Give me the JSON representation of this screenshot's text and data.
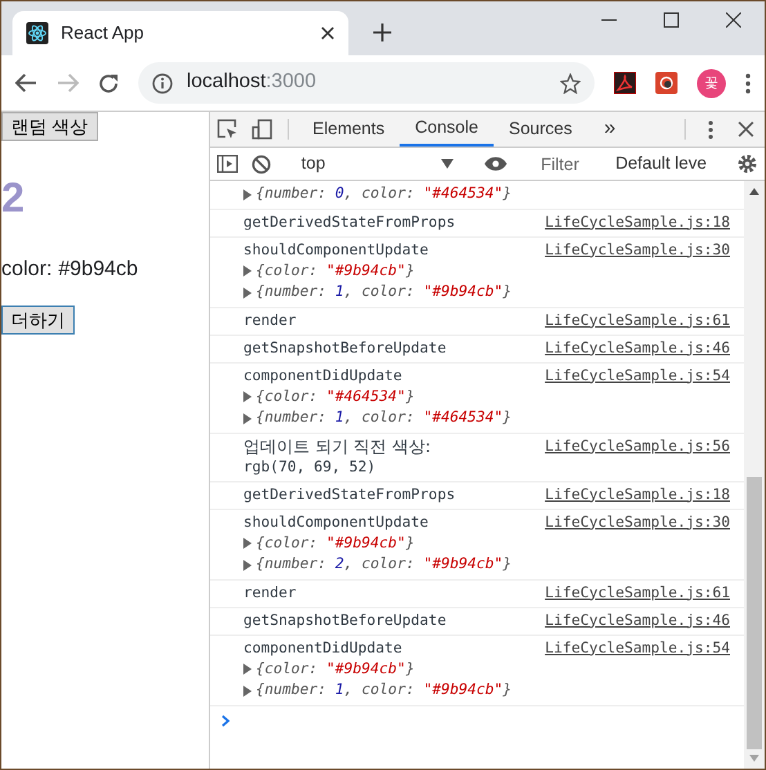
{
  "browser": {
    "tab_title": "React App",
    "url_host": "localhost",
    "url_port": ":3000",
    "forward_disabled": true,
    "avatar_label": "꽃"
  },
  "page": {
    "random_button": "랜덤 색상",
    "number": "2",
    "number_color": "#9b94cb",
    "color_key": "color:",
    "add_button": "더하기"
  },
  "devtools": {
    "tabs": [
      {
        "label": "Elements",
        "selected": false
      },
      {
        "label": "Console",
        "selected": true
      },
      {
        "label": "Sources",
        "selected": false
      }
    ],
    "more_tabs": "»",
    "context": "top",
    "filter_placeholder": "Filter",
    "levels": "Default leve"
  },
  "console": [
    {
      "objects": [
        [
          {
            "kind": "plain",
            "text": "{number: "
          },
          {
            "kind": "number",
            "text": "0"
          },
          {
            "kind": "plain",
            "text": ", color: "
          },
          {
            "kind": "string",
            "text": "\"#464534\""
          },
          {
            "kind": "plain",
            "text": "}"
          }
        ]
      ]
    },
    {
      "lines": [
        "getDerivedStateFromProps"
      ],
      "source": "LifeCycleSample.js:18"
    },
    {
      "lines": [
        "shouldComponentUpdate"
      ],
      "source": "LifeCycleSample.js:30",
      "objects": [
        [
          {
            "kind": "plain",
            "text": "{color: "
          },
          {
            "kind": "string",
            "text": "\"#9b94cb\""
          },
          {
            "kind": "plain",
            "text": "}"
          }
        ],
        [
          {
            "kind": "plain",
            "text": "{number: "
          },
          {
            "kind": "number",
            "text": "1"
          },
          {
            "kind": "plain",
            "text": ", color: "
          },
          {
            "kind": "string",
            "text": "\"#9b94cb\""
          },
          {
            "kind": "plain",
            "text": "}"
          }
        ]
      ]
    },
    {
      "lines": [
        "render"
      ],
      "source": "LifeCycleSample.js:61"
    },
    {
      "lines": [
        "getSnapshotBeforeUpdate"
      ],
      "source": "LifeCycleSample.js:46"
    },
    {
      "lines": [
        "componentDidUpdate"
      ],
      "source": "LifeCycleSample.js:54",
      "objects": [
        [
          {
            "kind": "plain",
            "text": "{color: "
          },
          {
            "kind": "string",
            "text": "\"#464534\""
          },
          {
            "kind": "plain",
            "text": "}"
          }
        ],
        [
          {
            "kind": "plain",
            "text": "{number: "
          },
          {
            "kind": "number",
            "text": "1"
          },
          {
            "kind": "plain",
            "text": ", color: "
          },
          {
            "kind": "string",
            "text": "\"#464534\""
          },
          {
            "kind": "plain",
            "text": "}"
          }
        ]
      ]
    },
    {
      "lines": [
        "업데이트 되기 직전 색상:",
        "rgb(70, 69, 52)"
      ],
      "source": "LifeCycleSample.js:56"
    },
    {
      "lines": [
        "getDerivedStateFromProps"
      ],
      "source": "LifeCycleSample.js:18"
    },
    {
      "lines": [
        "shouldComponentUpdate"
      ],
      "source": "LifeCycleSample.js:30",
      "objects": [
        [
          {
            "kind": "plain",
            "text": "{color: "
          },
          {
            "kind": "string",
            "text": "\"#9b94cb\""
          },
          {
            "kind": "plain",
            "text": "}"
          }
        ],
        [
          {
            "kind": "plain",
            "text": "{number: "
          },
          {
            "kind": "number",
            "text": "2"
          },
          {
            "kind": "plain",
            "text": ", color: "
          },
          {
            "kind": "string",
            "text": "\"#9b94cb\""
          },
          {
            "kind": "plain",
            "text": "}"
          }
        ]
      ]
    },
    {
      "lines": [
        "render"
      ],
      "source": "LifeCycleSample.js:61"
    },
    {
      "lines": [
        "getSnapshotBeforeUpdate"
      ],
      "source": "LifeCycleSample.js:46"
    },
    {
      "lines": [
        "componentDidUpdate"
      ],
      "source": "LifeCycleSample.js:54",
      "objects": [
        [
          {
            "kind": "plain",
            "text": "{color: "
          },
          {
            "kind": "string",
            "text": "\"#9b94cb\""
          },
          {
            "kind": "plain",
            "text": "}"
          }
        ],
        [
          {
            "kind": "plain",
            "text": "{number: "
          },
          {
            "kind": "number",
            "text": "1"
          },
          {
            "kind": "plain",
            "text": ", color: "
          },
          {
            "kind": "string",
            "text": "\"#9b94cb\""
          },
          {
            "kind": "plain",
            "text": "}"
          }
        ]
      ]
    }
  ]
}
